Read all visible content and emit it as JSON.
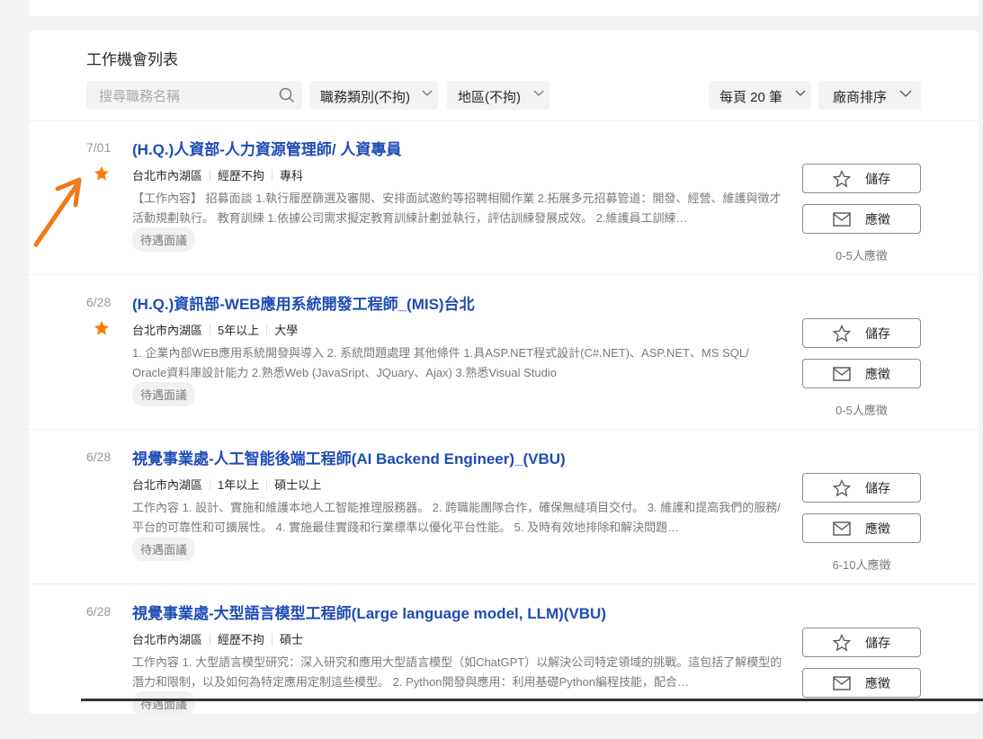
{
  "list": {
    "title": "工作機會列表",
    "search_placeholder": "搜尋職務名稱",
    "category": "職務類別(不拘)",
    "area": "地區(不拘)",
    "per_page": "每頁 20 筆",
    "sort": "廠商排序"
  },
  "buttons": {
    "save": "儲存",
    "apply": "應徵"
  },
  "colors": {
    "accent": "#1f4cb5",
    "star": "#ff7800",
    "annotation": "#f07a1a"
  },
  "jobs": [
    {
      "date": "7/01",
      "starred": true,
      "title": "(H.Q.)人資部-人力資源管理師/ 人資專員",
      "location": "台北市內湖區",
      "experience": "經歷不拘",
      "education": "專科",
      "desc": "【工作內容】 招募面談 1.執行履歷篩選及審閱、安排面試邀約等招聘相關作業 2.拓展多元招募管道：開發、經營、維護與徵才活動規劃執行。 教育訓練 1.依據公司需求擬定教育訓練計劃並執行，評估訓練發展成效。 2.維護員工訓練…",
      "tag": "待遇面議",
      "applicants": "0-5人應徵"
    },
    {
      "date": "6/28",
      "starred": true,
      "title": "(H.Q.)資訊部-WEB應用系統開發工程師_(MIS)台北",
      "location": "台北市內湖區",
      "experience": "5年以上",
      "education": "大學",
      "desc": "1. 企業內部WEB應用系統開發與導入 2. 系統問題處理 其他條件 1.具ASP.NET程式設計(C#.NET)、ASP.NET、MS SQL/ Oracle資料庫設計能力 2.熟悉Web (JavaSript、JQuary、Ajax) 3.熟悉Visual Studio",
      "tag": "待遇面議",
      "applicants": "0-5人應徵"
    },
    {
      "date": "6/28",
      "starred": false,
      "title": "視覺事業處-人工智能後端工程師(AI Backend Engineer)_(VBU)",
      "location": "台北市內湖區",
      "experience": "1年以上",
      "education": "碩士以上",
      "desc": "工作內容 1. 設計、實施和維護本地人工智能推理服務器。 2. 跨職能團隊合作，確保無縫項目交付。 3. 維護和提高我們的服務/平台的可靠性和可擴展性。 4. 實施最佳實踐和行業標準以優化平台性能。 5. 及時有效地排除和解決問題…",
      "tag": "待遇面議",
      "applicants": "6-10人應徵"
    },
    {
      "date": "6/28",
      "starred": false,
      "title": "視覺事業處-大型語言模型工程師(Large language model, LLM)(VBU)",
      "location": "台北市內湖區",
      "experience": "經歷不拘",
      "education": "碩士",
      "desc": "工作內容 1. 大型語言模型研究：深入研究和應用大型語言模型（如ChatGPT）以解決公司特定領域的挑戰。這包括了解模型的潛力和限制，以及如何為特定應用定制這些模型。 2. Python開發與應用：利用基礎Python編程技能，配合…",
      "tag": "待遇面議",
      "applicants": ""
    }
  ]
}
